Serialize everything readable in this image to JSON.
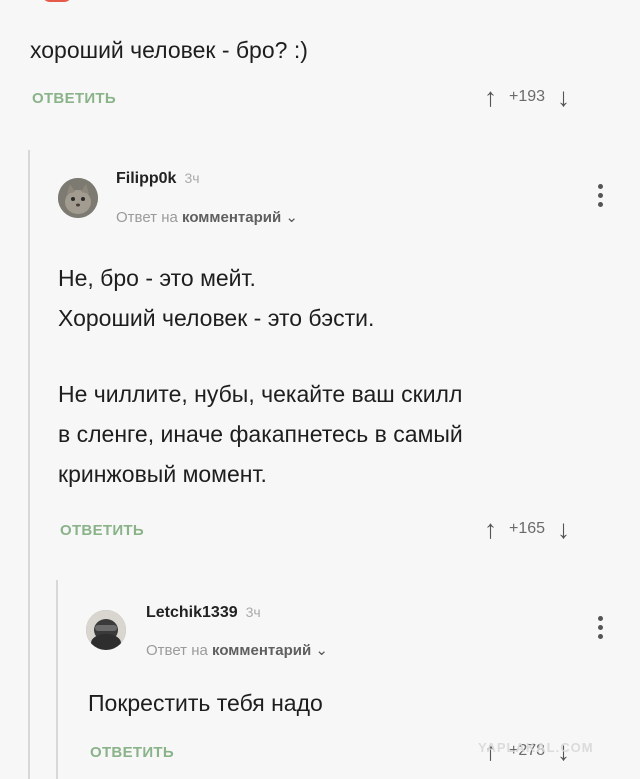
{
  "top_comment": {
    "text": "хороший человек - бро? :)",
    "reply_label": "ОТВЕТИТЬ",
    "votes": "+193"
  },
  "comment_1": {
    "username": "Filipp0k",
    "time": "3ч",
    "meta_prefix": "Ответ на",
    "meta_link": "комментарий",
    "paragraphs": [
      "Не, бро - это мейт.",
      "Хороший человек - это бэсти.",
      "Не чиллите, нубы, чекайте ваш скилл",
      "в сленге, иначе факапнетесь в самый",
      "кринжовый момент."
    ],
    "reply_label": "ОТВЕТИТЬ",
    "votes": "+165"
  },
  "comment_2": {
    "username": "Letchik1339",
    "time": "3ч",
    "meta_prefix": "Ответ на",
    "meta_link": "комментарий",
    "text": "Покрестить тебя надо",
    "reply_label": "ОТВЕТИТЬ",
    "votes": "+278"
  },
  "icons": {
    "up": "arrow-up-icon",
    "down": "arrow-down-icon",
    "more": "more-vertical-icon",
    "chevron": "chevron-down-icon"
  },
  "colors": {
    "reply_green": "#8ab38a",
    "background": "#f7f7f7",
    "thread_line": "#d8d8d8"
  },
  "watermark": "YAPLAKAL.COM"
}
